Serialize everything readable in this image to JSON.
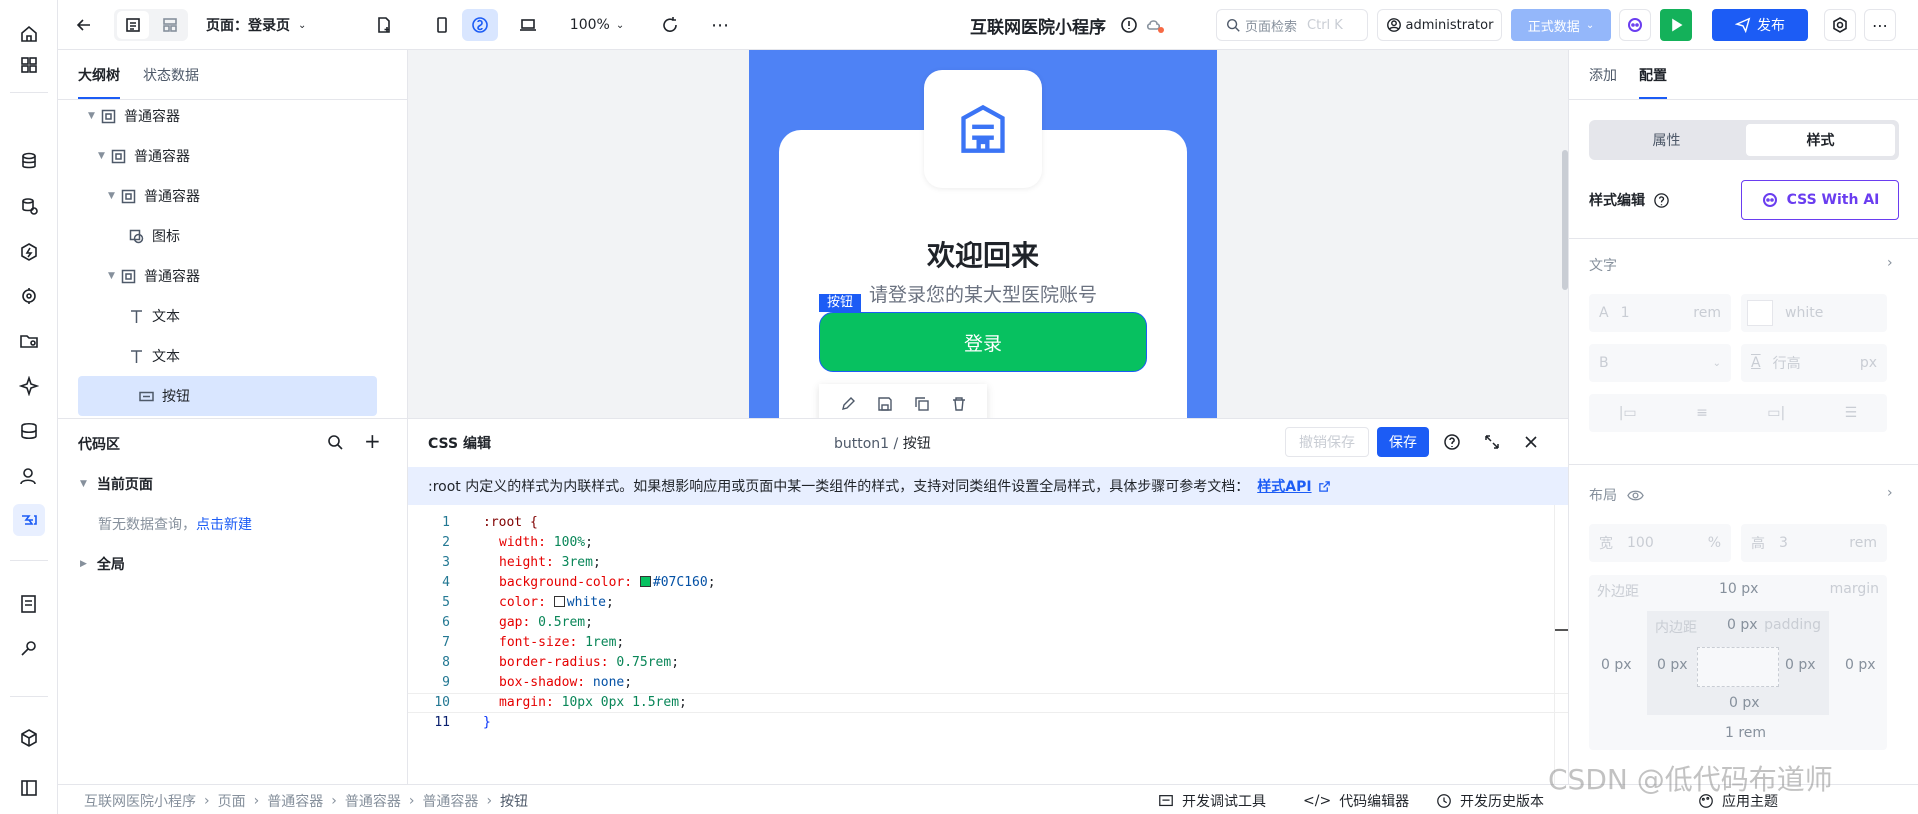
{
  "rail": {
    "icons": [
      "home-icon",
      "apps-icon",
      "database-icon",
      "data-source-icon",
      "logic-icon",
      "api-icon",
      "folder-icon",
      "ai-sparkle-icon",
      "storage-icon",
      "user-permission-icon",
      "code-link-icon",
      "report-icon",
      "plugin-icon",
      "package-icon",
      "exit-icon"
    ]
  },
  "top": {
    "page_label": "页面：登录页",
    "zoom": "100%",
    "app_title": "互联网医院小程序",
    "search_placeholder": "页面检索",
    "search_shortcut": "Ctrl K",
    "user": "administrator",
    "env": "正式数据",
    "publish": "发布"
  },
  "left": {
    "tabs": [
      "大纲树",
      "状态数据"
    ],
    "tree": [
      {
        "label": "普通容器",
        "type": "container"
      },
      {
        "label": "普通容器",
        "type": "container"
      },
      {
        "label": "普通容器",
        "type": "container"
      },
      {
        "label": "图标",
        "type": "icon"
      },
      {
        "label": "普通容器",
        "type": "container"
      },
      {
        "label": "文本",
        "type": "text"
      },
      {
        "label": "文本",
        "type": "text"
      },
      {
        "label": "按钮",
        "type": "button"
      }
    ],
    "code_area": {
      "title": "代码区",
      "current_page": "当前页面",
      "empty_text": "暂无数据查询，",
      "create_link": "点击新建",
      "global": "全局"
    }
  },
  "canvas": {
    "welcome": "欢迎回来",
    "subtitle": "请登录您的某大型医院账号",
    "tag": "按钮",
    "button": "登录"
  },
  "editor": {
    "title": "CSS 编辑",
    "path_component": "button1",
    "path_sep": "/",
    "path_name": "按钮",
    "undo": "撤销保存",
    "save": "保存",
    "notice": ":root 内定义的样式为内联样式。如果想影响应用或页面中某一类组件的样式，支持对同类组件设置全局样式，具体步骤可参考文档：",
    "notice_link": "样式API",
    "line_numbers": [
      "1",
      "2",
      "3",
      "4",
      "5",
      "6",
      "7",
      "8",
      "9",
      "10",
      "11"
    ],
    "code": {
      "l1": ":root {",
      "l2p": "width:",
      "l2v": "100%",
      "l3p": "height:",
      "l3v": "3rem",
      "l4p": "background-color:",
      "l4v": "#07C160",
      "l5p": "color:",
      "l5v": "white",
      "l6p": "gap:",
      "l6v": "0.5rem",
      "l7p": "font-size:",
      "l7v": "1rem",
      "l8p": "border-radius:",
      "l8v": "0.75rem",
      "l9p": "box-shadow:",
      "l9v": "none",
      "l10p": "margin:",
      "l10v": "10px 0px 1.5rem",
      "l11": "}"
    },
    "swatch_green": "#07C160",
    "swatch_white": "#ffffff"
  },
  "right": {
    "tabs": [
      "添加",
      "配置"
    ],
    "seg": [
      "属性",
      "样式"
    ],
    "style_edit": "样式编辑",
    "ai_btn": "CSS With AI",
    "text_section": "文字",
    "font_size": "1",
    "font_unit": "rem",
    "color_value": "white",
    "weight": "B",
    "line_height_ph": "行高",
    "line_unit": "px",
    "layout_section": "布局",
    "width_label": "宽",
    "width_value": "100",
    "width_unit": "%",
    "height_label": "高",
    "height_value": "3",
    "height_unit": "rem",
    "margin_label": "外边距",
    "margin_top": "10 px",
    "margin_tag": "margin",
    "padding_label": "内边距",
    "padding_top": "0 px",
    "padding_tag": "padding",
    "m_left": "0 px",
    "p_left": "0 px",
    "p_right": "0 px",
    "m_right": "0 px",
    "p_bottom": "0 px",
    "m_bottom": "1 rem"
  },
  "bottom": {
    "breadcrumb": [
      "互联网医院小程序",
      "页面",
      "普通容器",
      "普通容器",
      "普通容器",
      "按钮"
    ],
    "dev_tools": "开发调试工具",
    "code_editor": "代码编辑器",
    "history": "开发历史版本",
    "theme": "应用主题"
  },
  "watermark": "CSDN @低代码布道师",
  "colors": {
    "accent": "#1c5cf5",
    "button_green": "#07C160",
    "canvas_blue": "#4e82f5"
  }
}
